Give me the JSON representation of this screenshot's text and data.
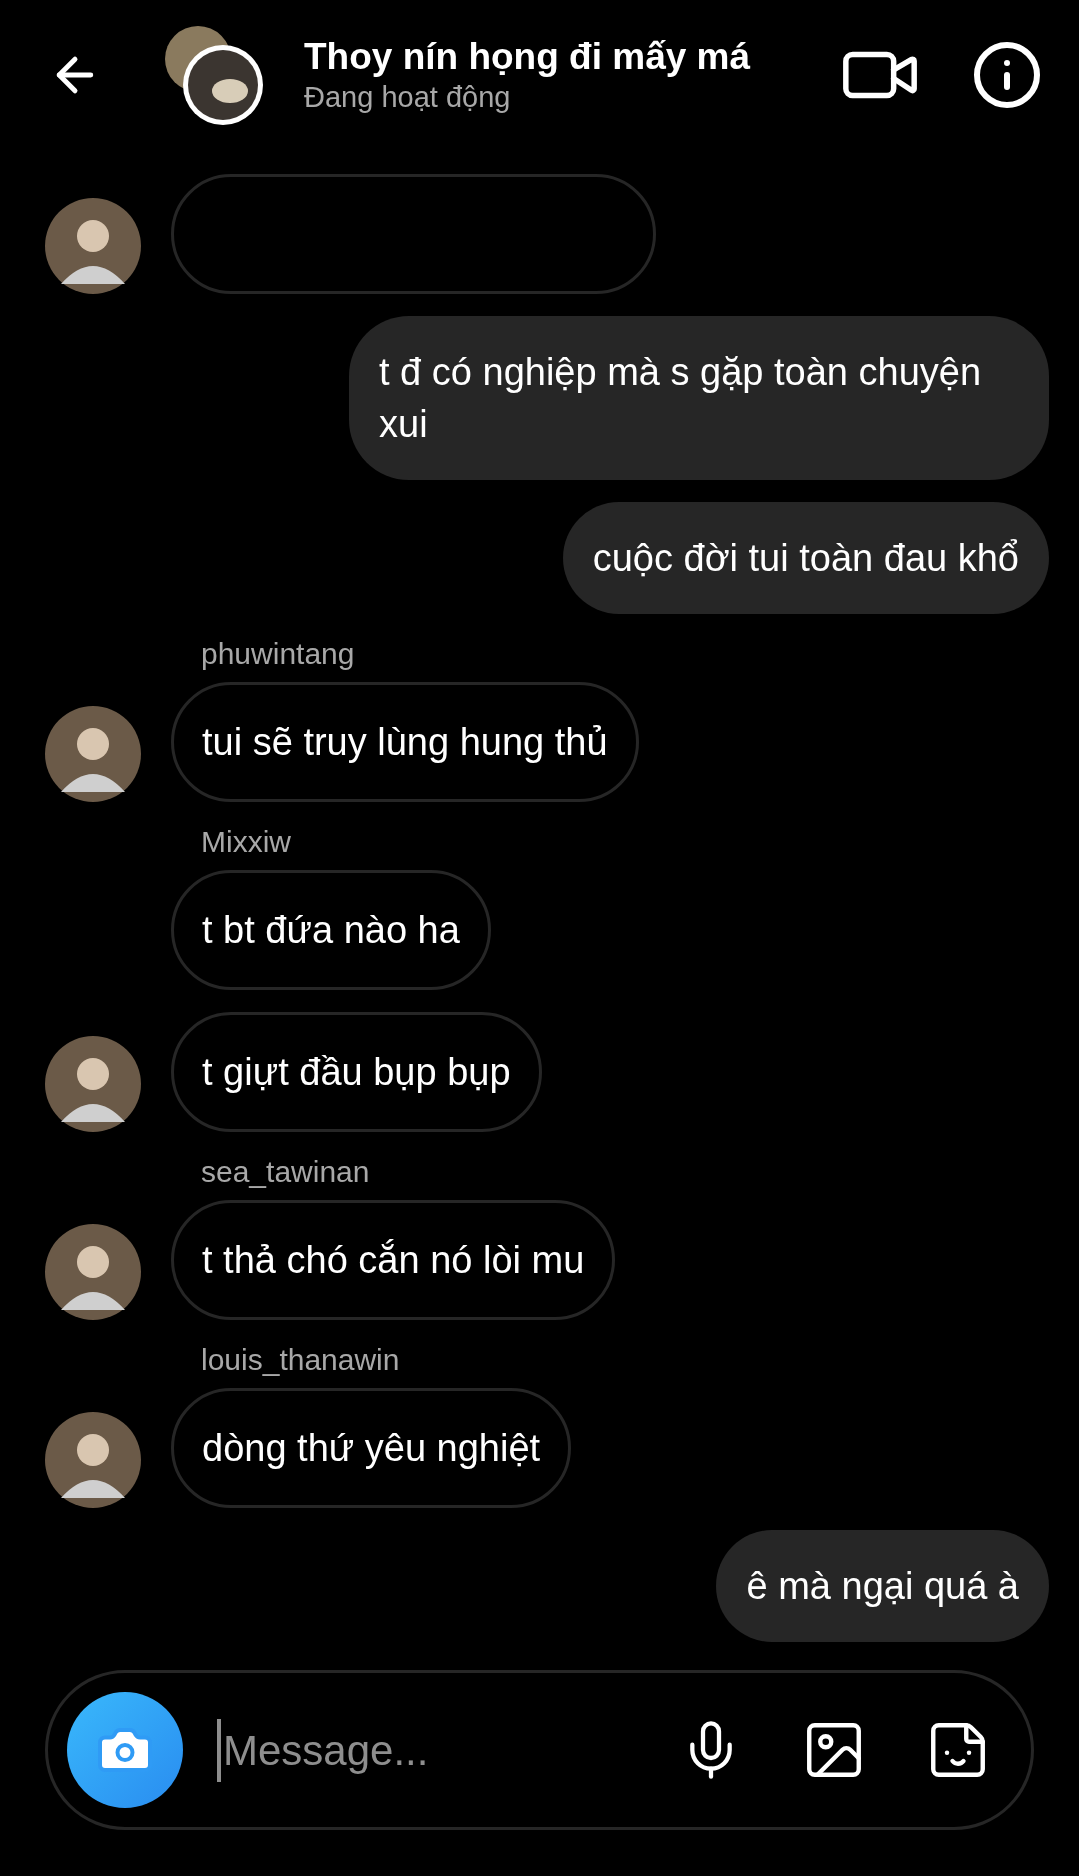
{
  "header": {
    "title": "Thoy nín họng đi mấy má",
    "status": "Đang hoạt động"
  },
  "messages": [
    {
      "kind": "incoming",
      "avatar": true
    },
    {
      "kind": "outgoing",
      "text": "t đ có nghiệp mà s gặp toàn chuyện xui"
    },
    {
      "kind": "outgoing",
      "text": "cuộc đời tui toàn đau khổ"
    },
    {
      "kind": "incoming",
      "sender": "phuwintang",
      "avatar": true,
      "text": "tui sẽ truy lùng hung thủ"
    },
    {
      "kind": "incoming",
      "sender": "Mixxiw",
      "avatar": false,
      "text": "t bt đứa nào ha"
    },
    {
      "kind": "incoming",
      "avatar": true,
      "text": "t giựt đầu bụp bụp"
    },
    {
      "kind": "incoming",
      "sender": "sea_tawinan",
      "avatar": true,
      "text": "t thả chó cắn nó lòi mu"
    },
    {
      "kind": "incoming",
      "sender": "louis_thanawin",
      "avatar": true,
      "text": "dòng thứ yêu nghiệt"
    },
    {
      "kind": "outgoing",
      "text": "ê mà ngại quá à"
    }
  ],
  "composer": {
    "placeholder": "Message..."
  }
}
